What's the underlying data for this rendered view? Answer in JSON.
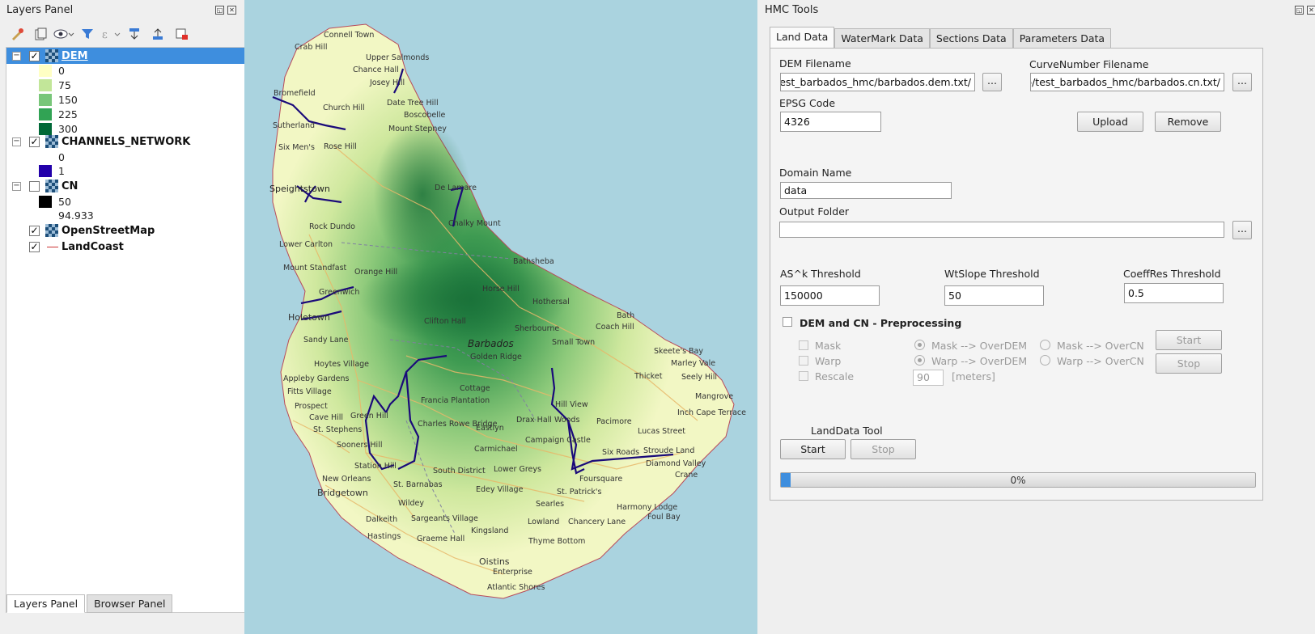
{
  "layers_panel": {
    "title": "Layers Panel",
    "layers": [
      {
        "name": "DEM",
        "checked": true,
        "legend": [
          {
            "label": "0",
            "color": "#ffffc4"
          },
          {
            "label": "75",
            "color": "#c2e699"
          },
          {
            "label": "150",
            "color": "#78c679"
          },
          {
            "label": "225",
            "color": "#31a354"
          },
          {
            "label": "300",
            "color": "#006837"
          }
        ]
      },
      {
        "name": "CHANNELS_NETWORK",
        "checked": true,
        "legend": [
          {
            "label": "0",
            "color": ""
          },
          {
            "label": "1",
            "color": "#2200aa"
          }
        ]
      },
      {
        "name": "CN",
        "checked": false,
        "legend": [
          {
            "label": "50",
            "color": "#000000"
          },
          {
            "label": "94.933",
            "color": ""
          }
        ]
      },
      {
        "name": "OpenStreetMap",
        "checked": true,
        "legend": []
      },
      {
        "name": "LandCoast",
        "checked": true,
        "legend": []
      }
    ],
    "tabs": [
      "Layers Panel",
      "Browser Panel"
    ]
  },
  "map": {
    "places": [
      "Connell Town",
      "Crab Hill",
      "Upper Salmonds",
      "Chance Hall",
      "Josey Hill",
      "Bromefield",
      "Church Hill",
      "Date Tree Hill",
      "Boscobelle",
      "Sutherland",
      "Mount Stepney",
      "Six Men's",
      "Rose Hill",
      "Speightstown",
      "De Lamare",
      "Chalky Mount",
      "Rock Dundo",
      "Lower Carlton",
      "Mount Standfast",
      "Orange Hill",
      "Bathsheba",
      "Horse Hill",
      "Greenwich",
      "Hothersal",
      "Holetown",
      "Bath",
      "Coach Hill",
      "Clifton Hall",
      "Sherbourne",
      "Sandy Lane",
      "Small Town",
      "Skeete's Bay",
      "Barbados",
      "Golden Ridge",
      "Marley Vale",
      "Hoytes Village",
      "Seely Hill",
      "Appleby Gardens",
      "Thicket",
      "Fitts Village",
      "Cottage",
      "Prospect",
      "Mangrove",
      "Cave Hill",
      "Green Hill",
      "Francia Plantation",
      "Hill View",
      "Inch Cape Terrace",
      "St. Stephens",
      "Charles Rowe Bridge",
      "Drax Hall Woods",
      "Pacimore",
      "Eastlyn",
      "Lucas Street",
      "Campaign Castle",
      "Carmichael",
      "Six Roads",
      "Stroude Land",
      "Diamond Valley",
      "Sooners Hill",
      "Station Hill",
      "South District",
      "Lower Greys",
      "Foursquare",
      "Crane",
      "New Orleans",
      "Bridgetown",
      "St. Barnabas",
      "Edey Village",
      "St. Patrick's",
      "Foul Bay",
      "Wildey",
      "Searles",
      "Harmony Lodge",
      "Dalkeith",
      "Sargeants Village",
      "Lowland",
      "Chancery Lane",
      "Kingsland",
      "Thyme Bottom",
      "Hastings",
      "Graeme Hall",
      "Oistins",
      "Enterprise",
      "Atlantic Shores"
    ]
  },
  "hmc": {
    "title": "HMC Tools",
    "tabs": [
      "Land Data",
      "WaterMark Data",
      "Sections Data",
      "Parameters Data"
    ],
    "dem_filename_label": "DEM Filename",
    "dem_filename_value": "/home/user/Desktop/test_barbados_hmc/barbados.dem.txt",
    "cn_filename_label": "CurveNumber Filename",
    "cn_filename_value": "/home/user/Desktop/test_barbados_hmc/barbados.cn.txt",
    "browse_label": "...",
    "epsg_label": "EPSG Code",
    "epsg_value": "4326",
    "upload_label": "Upload",
    "remove_label": "Remove",
    "domain_label": "Domain Name",
    "domain_value": "data",
    "output_label": "Output Folder",
    "output_value": "",
    "ask_label": "AS^k Threshold",
    "ask_value": "150000",
    "wtslope_label": "WtSlope Threshold",
    "wtslope_value": "50",
    "coeffres_label": "CoeffRes Threshold",
    "coeffres_value": "0.5",
    "preproc_label": "DEM and CN - Preprocessing",
    "mask_label": "Mask",
    "warp_label": "Warp",
    "rescale_label": "Rescale",
    "mask_overdem": "Mask --> OverDEM",
    "warp_overdem": "Warp --> OverDEM",
    "mask_overcn": "Mask --> OverCN",
    "warp_overcn": "Warp --> OverCN",
    "rescale_value": "90",
    "rescale_unit": "[meters]",
    "pre_start": "Start",
    "pre_stop": "Stop",
    "landdata_tool_label": "LandData Tool",
    "tool_start": "Start",
    "tool_stop": "Stop",
    "progress_text": "0%",
    "progress": 0
  }
}
